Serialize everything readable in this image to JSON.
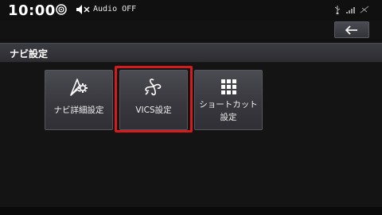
{
  "status_bar": {
    "clock": "10:00",
    "audio_status": "Audio OFF",
    "icons": [
      "navigation-status-icon",
      "mute-icon",
      "usb-icon",
      "signal-icon",
      "gps-icon"
    ]
  },
  "header": {
    "title": "ナビ設定",
    "back_icon": "back-arrow-icon"
  },
  "menu": {
    "items": [
      {
        "label": "ナビ詳細設定",
        "icon": "nav-settings-icon",
        "selected": false
      },
      {
        "label": "VICS設定",
        "icon": "vics-icon",
        "selected": true
      },
      {
        "label_line1": "ショートカット",
        "label_line2": "設定",
        "icon": "grid-icon",
        "selected": false
      }
    ]
  },
  "colors": {
    "background": "#141414",
    "tile": "#3e3e44",
    "selection": "#d41c1c",
    "text": "#ffffff"
  }
}
